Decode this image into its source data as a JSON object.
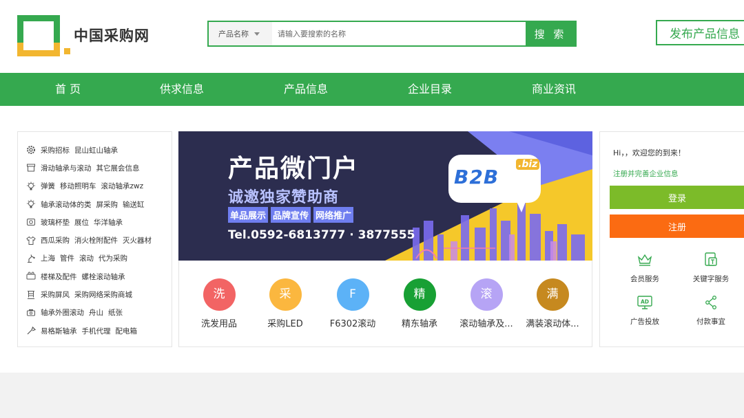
{
  "header": {
    "logo_text": "中国采购网",
    "search": {
      "category": "产品名称",
      "placeholder": "请输入要搜索的名称",
      "button": "搜 索"
    },
    "publish_button": "发布产品信息"
  },
  "nav": {
    "items": [
      "首 页",
      "供求信息",
      "产品信息",
      "企业目录",
      "商业资讯"
    ]
  },
  "categories": [
    {
      "icon": "gear-icon",
      "links": [
        "采购招标",
        "昆山虹山轴承"
      ]
    },
    {
      "icon": "box-icon",
      "links": [
        "滑动轴承与滚动",
        "其它展会信息"
      ]
    },
    {
      "icon": "bulb-icon",
      "links": [
        "弹簧",
        "移动照明车",
        "滚动轴承zwz"
      ]
    },
    {
      "icon": "bulb-icon",
      "links": [
        "轴承滚动体的类",
        "屏采购",
        "输送缸"
      ]
    },
    {
      "icon": "camera-icon",
      "links": [
        "玻璃杯垫",
        "展位",
        "华洋轴承"
      ]
    },
    {
      "icon": "shirt-icon",
      "links": [
        "西瓜采购",
        "消火栓附配件",
        "灭火器材"
      ]
    },
    {
      "icon": "robot-arm-icon",
      "links": [
        "上海",
        "管件",
        "滚动",
        "代为采购"
      ]
    },
    {
      "icon": "projector-icon",
      "links": [
        "楼梯及配件",
        "螺栓滚动轴承"
      ]
    },
    {
      "icon": "screen-icon",
      "links": [
        "采购屏风",
        "采购网络采购商城"
      ]
    },
    {
      "icon": "cart-icon",
      "links": [
        "轴承外圈滚动",
        "舟山",
        "纸张"
      ]
    },
    {
      "icon": "tool-icon",
      "links": [
        "易格斯轴承",
        "手机代理",
        "配电箱"
      ]
    }
  ],
  "banner": {
    "title": "产品微门户",
    "subtitle": "诚邀独家赞助商",
    "tags": [
      "单品展示",
      "品牌宣传",
      "网络推广"
    ],
    "tel": "Tel.0592-6813777 · 3877555",
    "badge": "B2B",
    "badge_suffix": ".biz"
  },
  "products": [
    {
      "char": "洗",
      "label": "洗发用品",
      "color": "#f26464"
    },
    {
      "char": "采",
      "label": "采购LED",
      "color": "#fbb73f"
    },
    {
      "char": "F",
      "label": "F6302滚动",
      "color": "#5cb2f7"
    },
    {
      "char": "精",
      "label": "精东轴承",
      "color": "#18a034"
    },
    {
      "char": "滚",
      "label": "滚动轴承及...",
      "color": "#b6a4f5"
    },
    {
      "char": "满",
      "label": "满装滚动体...",
      "color": "#c6891f"
    }
  ],
  "side": {
    "greeting": "Hi，，欢迎您的到来！",
    "register_link": "注册并完善企业信息",
    "login": "登录",
    "register": "注册",
    "services": [
      {
        "icon": "crown-icon",
        "label": "会员服务"
      },
      {
        "icon": "keyword-icon",
        "label": "关键字服务"
      },
      {
        "icon": "ad-icon",
        "label": "广告投放"
      },
      {
        "icon": "share-icon",
        "label": "付款事宜"
      }
    ]
  },
  "colors": {
    "brand_green": "#35a94f",
    "brand_yellow": "#f2b630",
    "login_green": "#7cbb29",
    "register_orange": "#fb6b12"
  }
}
